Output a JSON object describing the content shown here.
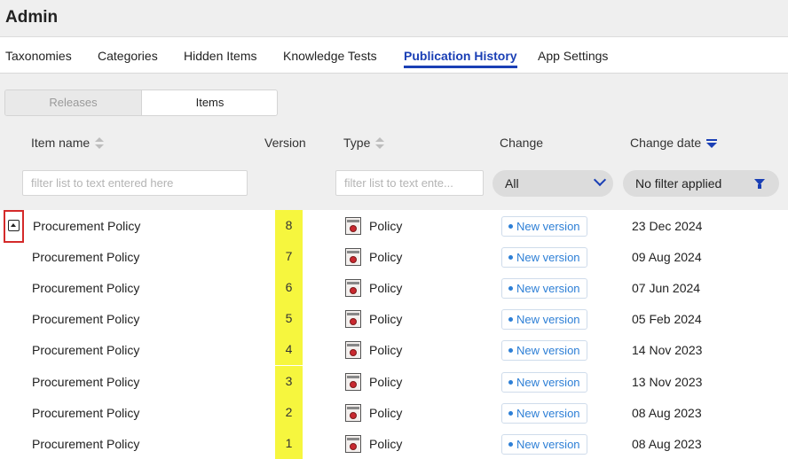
{
  "app": {
    "title": "Admin"
  },
  "tabs": [
    {
      "label": "Taxonomies"
    },
    {
      "label": "Categories"
    },
    {
      "label": "Hidden Items"
    },
    {
      "label": "Knowledge Tests"
    },
    {
      "label": "Publication History",
      "active": true
    },
    {
      "label": "App Settings"
    }
  ],
  "segmented": {
    "releases": "Releases",
    "items": "Items",
    "selected": "Items"
  },
  "columns": {
    "item_name": "Item name",
    "version": "Version",
    "type": "Type",
    "change": "Change",
    "change_date": "Change date"
  },
  "filters": {
    "item_name_placeholder": "filter list to text entered here",
    "type_placeholder": "filter list to text ente...",
    "change_value": "All",
    "date_value": "No filter applied"
  },
  "sort": {
    "column": "Change date",
    "direction": "descending"
  },
  "rows": [
    {
      "name": "Procurement Policy",
      "version": "8",
      "type": "Policy",
      "change": "New version",
      "date": "23 Dec 2024"
    },
    {
      "name": "Procurement Policy",
      "version": "7",
      "type": "Policy",
      "change": "New version",
      "date": "09 Aug 2024"
    },
    {
      "name": "Procurement Policy",
      "version": "6",
      "type": "Policy",
      "change": "New version",
      "date": "07 Jun 2024"
    },
    {
      "name": "Procurement Policy",
      "version": "5",
      "type": "Policy",
      "change": "New version",
      "date": "05 Feb 2024"
    },
    {
      "name": "Procurement Policy",
      "version": "4",
      "type": "Policy",
      "change": "New version",
      "date": "14 Nov 2023"
    },
    {
      "name": "Procurement Policy",
      "version": "3",
      "type": "Policy",
      "change": "New version",
      "date": "13 Nov 2023"
    },
    {
      "name": "Procurement Policy",
      "version": "2",
      "type": "Policy",
      "change": "New version",
      "date": "08 Aug 2023"
    },
    {
      "name": "Procurement Policy",
      "version": "1",
      "type": "Policy",
      "change": "New version",
      "date": "08 Aug 2023"
    }
  ],
  "icons": {
    "expand_toggle": "collapse-up-icon",
    "type_icon": "policy-document-icon",
    "sort_neutral": "sort-icon",
    "sort_active": "sort-descending-icon",
    "dropdown": "chevron-down-icon",
    "filter": "funnel-icon"
  },
  "colors": {
    "accent": "#1a3fb5",
    "version_highlight": "#f6f63e",
    "badge_text": "#2d7fd6",
    "expander_outline": "#d42a2a"
  }
}
